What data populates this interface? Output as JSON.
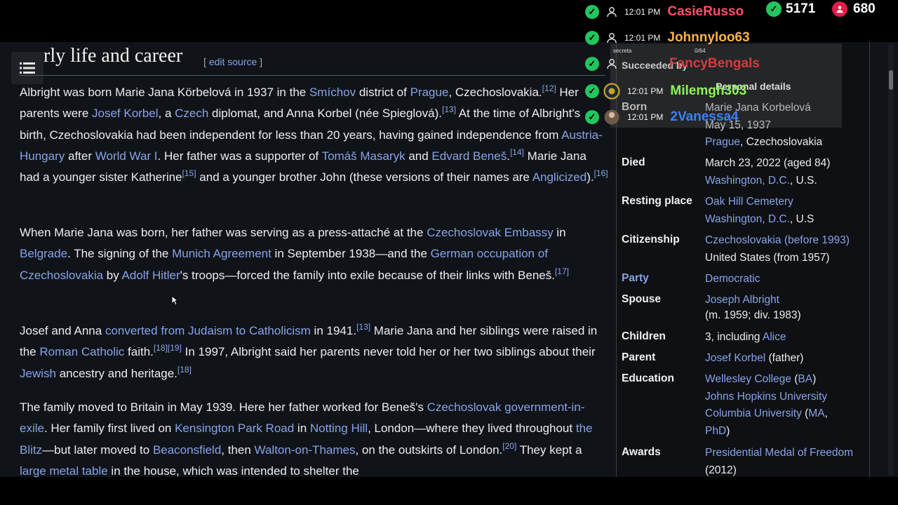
{
  "article": {
    "heading": "rly life and career",
    "edit_bracket_open": "[",
    "edit_link": "edit source",
    "edit_bracket_close": "]",
    "p1": {
      "t1": "Albright was born Marie Jana Körbelová in 1937 in the ",
      "l_smichov": "Smíchov",
      "t2": " district of ",
      "l_prague": "Prague",
      "t3": ", Czechoslovakia.",
      "r12": "[12]",
      "t4": " Her parents were ",
      "l_josef": "Josef Korbel",
      "t5": ", a ",
      "l_czech": "Czech",
      "t6": " diplomat, and Anna Korbel (née Spieglová).",
      "r13": "[13]",
      "t7": " At the time of Albright's birth, Czechoslovakia had been independent for less than 20 years, having gained independence from ",
      "l_austria": "Austria-Hungary",
      "t8": " after ",
      "l_ww1": "World War I",
      "t9": ". Her father was a supporter of ",
      "l_masaryk": "Tomáš Masaryk",
      "t10": " and ",
      "l_benes": "Edvard Beneš",
      "t11": ".",
      "r14": "[14]",
      "t12": " Marie Jana had a younger sister Katherine",
      "r15": "[15]",
      "t13": " and a younger brother John (these versions of their names are ",
      "l_anglicized": "Anglicized",
      "t14": ").",
      "r16": "[16]"
    },
    "p2": {
      "t1": "When Marie Jana was born, her father was serving as a press-attaché at the ",
      "l_embassy": "Czechoslovak Embassy",
      "t2": " in ",
      "l_belgrade": "Belgrade",
      "t3": ". The signing of the ",
      "l_munich": "Munich Agreement",
      "t4": " in September 1938—and the ",
      "l_occupation": "German occupation of Czechoslovakia",
      "t5": " by ",
      "l_hitler": "Adolf Hitler",
      "t6": "'s troops—forced the family into exile because of their links with Beneš.",
      "r17": "[17]"
    },
    "p3": {
      "t1": "Josef and Anna ",
      "l_converted": "converted from Judaism to Catholicism",
      "t2": " in 1941.",
      "r13": "[13]",
      "t3": " Marie Jana and her siblings were raised in the ",
      "l_roman": "Roman Catholic",
      "t4": " faith.",
      "r1819": "[18][19]",
      "t5": " In 1997, Albright said her parents never told her or her two siblings about their ",
      "l_jewish": "Jewish",
      "t6": " ancestry and heritage.",
      "r18": "[18]"
    },
    "p4": {
      "t1": "The family moved to Britain in May 1939. Here her father worked for Beneš's ",
      "l_govt": "Czechoslovak government-in-exile",
      "t2": ". Her family first lived on ",
      "l_kensington": "Kensington Park Road",
      "t3": " in ",
      "l_notting": "Notting Hill",
      "t4": ", London—where they lived throughout ",
      "l_blitz": "the Blitz",
      "t5": "—but later moved to ",
      "l_beaconsfield": "Beaconsfield",
      "t6": ", then ",
      "l_walton": "Walton-on-Thames",
      "t7": ", on the outskirts of London.",
      "r20": "[20]",
      "t8": " They kept a ",
      "l_table": "large metal table",
      "t9": " in the house, which was intended to shelter the"
    }
  },
  "infobox": {
    "born_label": "Born",
    "born_name": "Marie Jana Korbelová",
    "born_date": "May 15, 1937",
    "born_place_link": "Prague",
    "born_place_rest": ", Czechoslovakia",
    "died_label": "Died",
    "died_date": "March 23, 2022 (aged 84)",
    "died_place_link": "Washington, D.C.",
    "died_place_rest": ", U.S.",
    "resting_label": "Resting place",
    "resting_link1": "Oak Hill Cemetery",
    "resting_link2": "Washington, D.C.",
    "resting_rest": ", U.S",
    "citizenship_label": "Citizenship",
    "citizenship_link": "Czechoslovakia (before 1993)",
    "citizenship_rest": "United States (from 1957)",
    "party_label": "Party",
    "party_value": "Democratic",
    "spouse_label": "Spouse",
    "spouse_link": "Joseph Albright",
    "spouse_detail": "(m. 1959; div. 1983)",
    "children_label": "Children",
    "children_text": "3, including ",
    "children_link": "Alice",
    "parent_label": "Parent",
    "parent_link": "Josef Korbel",
    "parent_rest": " (father)",
    "education_label": "Education",
    "edu_link1": "Wellesley College",
    "edu_open1": " (",
    "edu_ba": "BA",
    "edu_close1": ")",
    "edu_link2": "Johns Hopkins University",
    "edu_link3": "Columbia University",
    "edu_open2": " (",
    "edu_ma": "MA",
    "edu_sep": ", ",
    "edu_phd": "PhD",
    "edu_close2": ")",
    "awards_label": "Awards",
    "awards_link": "Presidential Medal of Freedom",
    "awards_year": "(2012)"
  },
  "chat": {
    "rows": [
      {
        "time": "12:01 PM",
        "name": "CasieRusso",
        "color": "#ff4f6a"
      },
      {
        "time": "12:01 PM",
        "name": "Johnnyloo63",
        "color": "#ffb347"
      },
      {
        "time": "",
        "name": "FancyBengals",
        "color": "#d63b3b"
      },
      {
        "time": "12:01 PM",
        "name": "Milemgh303",
        "color": "#8cf55a"
      },
      {
        "time": "12:01 PM",
        "name": "2Vanessa4",
        "color": "#3b82f6"
      }
    ],
    "counter1": "5171",
    "counter2": "680",
    "overlay_text1": "Succeeded by",
    "overlay_text2": "Personal details",
    "overlay_small1": "secreta",
    "overlay_small2": "0/64"
  },
  "colors": {
    "link": "#88a3e8",
    "text": "#eaecf0",
    "page_bg": "#101418",
    "check_green": "#22c55e"
  }
}
